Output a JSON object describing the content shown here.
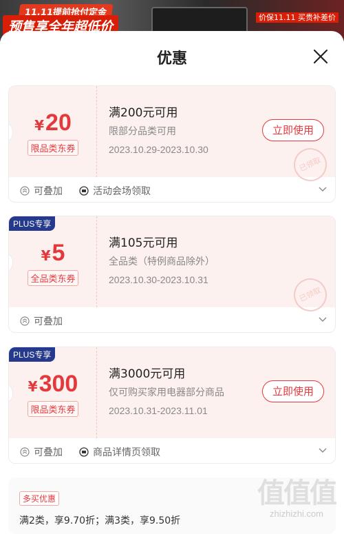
{
  "banner": {
    "line1": "11.11提前抢付定金",
    "line2": "预售享全年超低价",
    "right_badge": "价保11.11 买贵补差价"
  },
  "sheet": {
    "title": "优惠"
  },
  "coupons": [
    {
      "plus": "",
      "currency": "¥",
      "amount": "20",
      "tag": "限品类东券",
      "condition": "满200元可用",
      "scope": "限部分品类可用",
      "date": "2023.10.29-2023.10.30",
      "button": "立即使用",
      "stamp": "已领取",
      "stackable": "可叠加",
      "source": "活动会场领取"
    },
    {
      "plus": "PLUS专享",
      "currency": "¥",
      "amount": "5",
      "tag": "全品类东券",
      "condition": "满105元可用",
      "scope": "全品类（特例商品除外）",
      "date": "2023.10.30-2023.10.31",
      "button": "",
      "stamp": "已领取",
      "stackable": "可叠加",
      "source": ""
    },
    {
      "plus": "PLUS专享",
      "currency": "¥",
      "amount": "300",
      "tag": "限品类东券",
      "condition": "满3000元可用",
      "scope": "仅可购买家用电器部分商品",
      "date": "2023.10.31-2023.11.01",
      "button": "立即使用",
      "stamp": "",
      "stackable": "可叠加",
      "source": "商品详情页领取"
    }
  ],
  "multi_buy": {
    "tag": "多买优惠",
    "text": "满2类，享9.70折；满3类，享9.50折"
  },
  "watermark": {
    "glyphs": "值值值",
    "url": "zhizhizhi.com"
  },
  "colors": {
    "accent": "#e4393c",
    "plus_badge": "#253a8c",
    "card_bg": "#fdf1ef"
  }
}
